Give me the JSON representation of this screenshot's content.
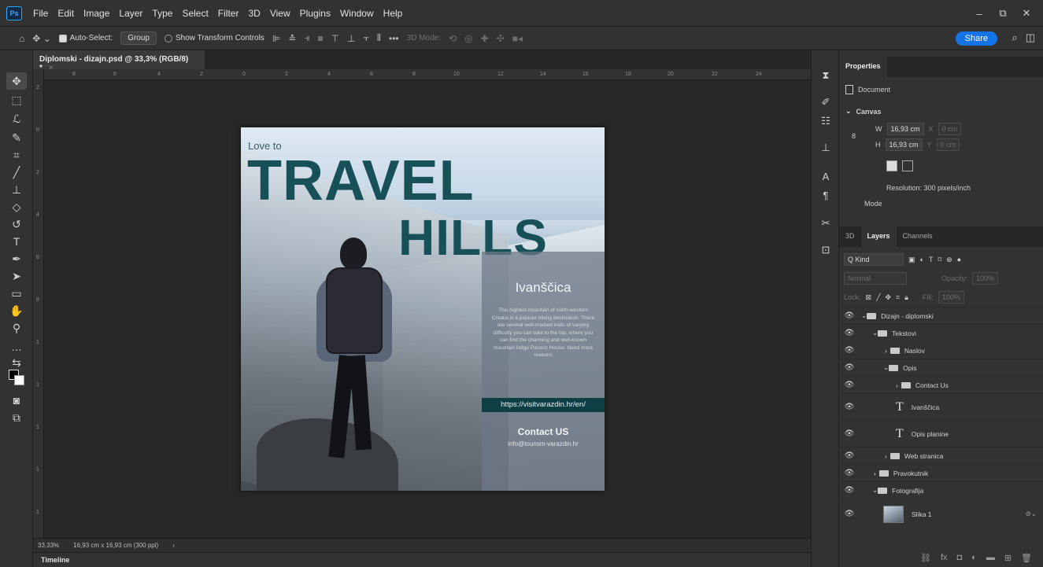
{
  "app": {
    "logo": "Ps"
  },
  "menu": [
    "File",
    "Edit",
    "Image",
    "Layer",
    "Type",
    "Select",
    "Filter",
    "3D",
    "View",
    "Plugins",
    "Window",
    "Help"
  ],
  "window_controls": [
    "–",
    "⧉",
    "✕"
  ],
  "options_bar": {
    "auto_select_label": "Auto-Select:",
    "auto_select_value": "Group",
    "show_transform_label": "Show Transform Controls",
    "mode_3d_label": "3D Mode:",
    "more": "•••",
    "share_label": "Share"
  },
  "document_tab": {
    "title": "Diplomski - dizajn.psd @ 33,3% (RGB/8) *",
    "close": "×"
  },
  "rulers": {
    "h_ticks": [
      "8",
      "6",
      "4",
      "2",
      "0",
      "2",
      "4",
      "6",
      "8",
      "10",
      "12",
      "14",
      "16",
      "18",
      "20",
      "22",
      "24"
    ],
    "v_ticks": [
      "2",
      "0",
      "2",
      "4",
      "6",
      "8",
      "1",
      "1",
      "1",
      "1",
      "1",
      "1",
      "1"
    ]
  },
  "poster": {
    "love_to": "Love to",
    "travel": "TRAVEL",
    "hills": "HILLS",
    "place": "Ivanščica",
    "description": "This highest mountain of north-western Croatia is a popular hiking destination. There are several well-marked trails of varying difficulty you can take to the top, where you can find the charming and well-known mountain lodge Pasarić House. Need more reasons",
    "url": "https://visitvarazdin.hr/en/",
    "contact": "Contact US",
    "email": "info@tourism-varazdin.hr"
  },
  "status_bar": {
    "zoom": "33,33%",
    "doc_size": "16,93 cm x 16,93 cm (300 ppi)",
    "arrow": "›"
  },
  "timeline": {
    "label": "Timeline"
  },
  "properties": {
    "tab": "Properties",
    "doc_label": "Document",
    "canvas_label": "Canvas",
    "w_label": "W",
    "w_value": "16,93 cm",
    "h_label": "H",
    "h_value": "16,93 cm",
    "x_label": "X",
    "x_value": "0 cm",
    "y_label": "Y",
    "y_value": "0 cm",
    "resolution": "Resolution: 300 pixels/inch",
    "mode": "Mode"
  },
  "layers_panel": {
    "tabs": [
      "3D",
      "Layers",
      "Channels"
    ],
    "kind": "Q Kind",
    "blend": "Normal",
    "opacity_label": "Opacity:",
    "opacity_value": "100%",
    "lock_label": "Lock:",
    "fill_label": "Fill:",
    "fill_value": "100%",
    "layers": [
      {
        "name": "Dizajn - diplomski",
        "type": "group-open",
        "indent": 0
      },
      {
        "name": "Tekstovi",
        "type": "group-open",
        "indent": 1
      },
      {
        "name": "Naslov",
        "type": "group",
        "indent": 2
      },
      {
        "name": "Opis",
        "type": "group-open",
        "indent": 2
      },
      {
        "name": "Contact Us",
        "type": "group",
        "indent": 3
      },
      {
        "name": "Ivanščica",
        "type": "text",
        "indent": 3
      },
      {
        "name": "Opis planine",
        "type": "text",
        "indent": 3
      },
      {
        "name": "Web stranica",
        "type": "group",
        "indent": 2
      },
      {
        "name": "Pravokutnik",
        "type": "group",
        "indent": 1
      },
      {
        "name": "Fotografija",
        "type": "group-open",
        "indent": 1
      },
      {
        "name": "Slika 1",
        "type": "image",
        "indent": 2
      }
    ]
  }
}
